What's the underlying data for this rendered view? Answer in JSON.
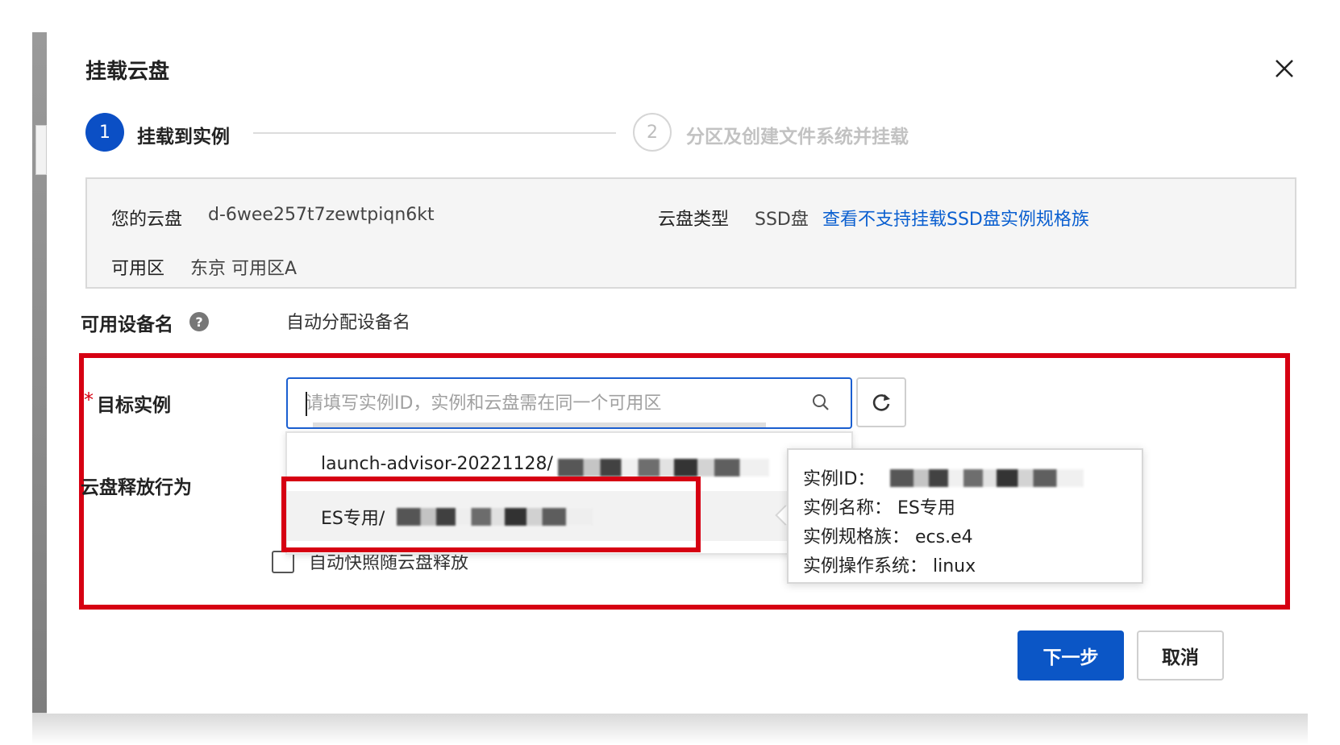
{
  "dialog": {
    "title": "挂载云盘",
    "close_icon": "close-icon"
  },
  "steps": [
    {
      "number": "1",
      "label": "挂载到实例",
      "state": "active"
    },
    {
      "number": "2",
      "label": "分区及创建文件系统并挂载",
      "state": "inactive"
    }
  ],
  "info": {
    "disk_label": "您的云盘",
    "disk_value": "d-6wee257t7zewtpiqn6kt",
    "type_label": "云盘类型",
    "type_value": "SSD盘",
    "type_link": "查看不支持挂载SSD盘实例规格族",
    "zone_label": "可用区",
    "zone_value": "东京 可用区A"
  },
  "form": {
    "device_label": "可用设备名",
    "device_value": "自动分配设备名",
    "help_icon": "?",
    "target_label": "目标实例",
    "required_mark": "*",
    "search_placeholder": "请填写实例ID，实例和云盘需在同一个可用区",
    "release_label": "云盘释放行为",
    "checkbox_label": "自动快照随云盘释放"
  },
  "dropdown": {
    "items": [
      {
        "label": "launch-advisor-20221128/"
      },
      {
        "label": "ES专用/"
      }
    ]
  },
  "popover": {
    "id_label": "实例ID：",
    "name_row": "实例名称： ES专用",
    "family_row": "实例规格族： ecs.e4",
    "os_row": "实例操作系统： linux"
  },
  "footer": {
    "next_label": "下一步",
    "cancel_label": "取消"
  },
  "colors": {
    "primary": "#0b56c6",
    "highlight_red": "#d60012",
    "link": "#0a5fd0"
  }
}
